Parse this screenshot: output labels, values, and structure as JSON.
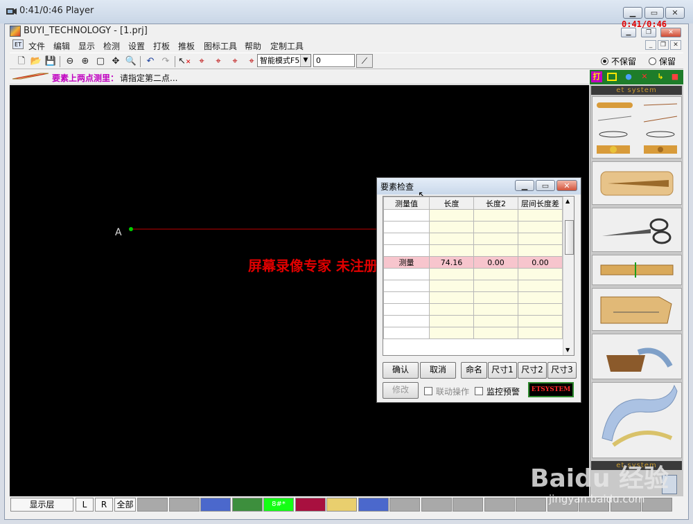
{
  "player": {
    "title": "0:41/0:46 Player",
    "timer": "0:41/0:46"
  },
  "app": {
    "title": "BUYI_TECHNOLOGY - [1.prj]"
  },
  "menu": [
    "文件",
    "编辑",
    "显示",
    "检测",
    "设置",
    "打板",
    "推板",
    "图标工具",
    "帮助",
    "定制工具"
  ],
  "toolbar": {
    "mode_value": "智能模式F5",
    "number_value": "0"
  },
  "options": {
    "no_keep": "不保留",
    "keep": "保留",
    "selected": "不保留"
  },
  "status": {
    "label": "要素上两点测里：",
    "text": "请指定第二点..."
  },
  "right_tools": {
    "da": "打"
  },
  "palette": {
    "header": "et system",
    "footer": "et system"
  },
  "canvas": {
    "point_label": "A",
    "line_color": "#c00000",
    "point_color": "#00cc00"
  },
  "watermark": "屏幕录像专家 未注册",
  "baidu": {
    "logo": "Baidu 经验",
    "url": "jingyan.baidu.com"
  },
  "dialog": {
    "title": "要素检查",
    "columns": [
      "测量值",
      "长度",
      "长度2",
      "层间长度差"
    ],
    "selected_row": {
      "name": "测量",
      "length": "74.16",
      "length2": "0.00",
      "diff": "0.00"
    },
    "buttons": {
      "ok": "确认",
      "cancel": "取消",
      "name": "命名",
      "size1": "尺寸1",
      "size2": "尺寸2",
      "size3": "尺寸3",
      "modify": "修改"
    },
    "link_op": "联动操作",
    "monitor": "监控预警",
    "brand": "ETSYSTEM"
  },
  "layerbar": {
    "show_layer": "显示层",
    "l": "L",
    "r": "R",
    "all": "全部",
    "active": "8#*",
    "swatches": [
      "#a9a9a9",
      "#a9a9a9",
      "#4b68cc",
      "#3d8f3d",
      "#14ff14",
      "#a8103f",
      "#e9cf6e",
      "#4b68cc",
      "#a9a9a9",
      "#a9a9a9",
      "#a9a9a9",
      "#a9a9a9",
      "#a9a9a9",
      "#a9a9a9",
      "#a9a9a9",
      "#a9a9a9",
      "#a9a9a9"
    ]
  }
}
